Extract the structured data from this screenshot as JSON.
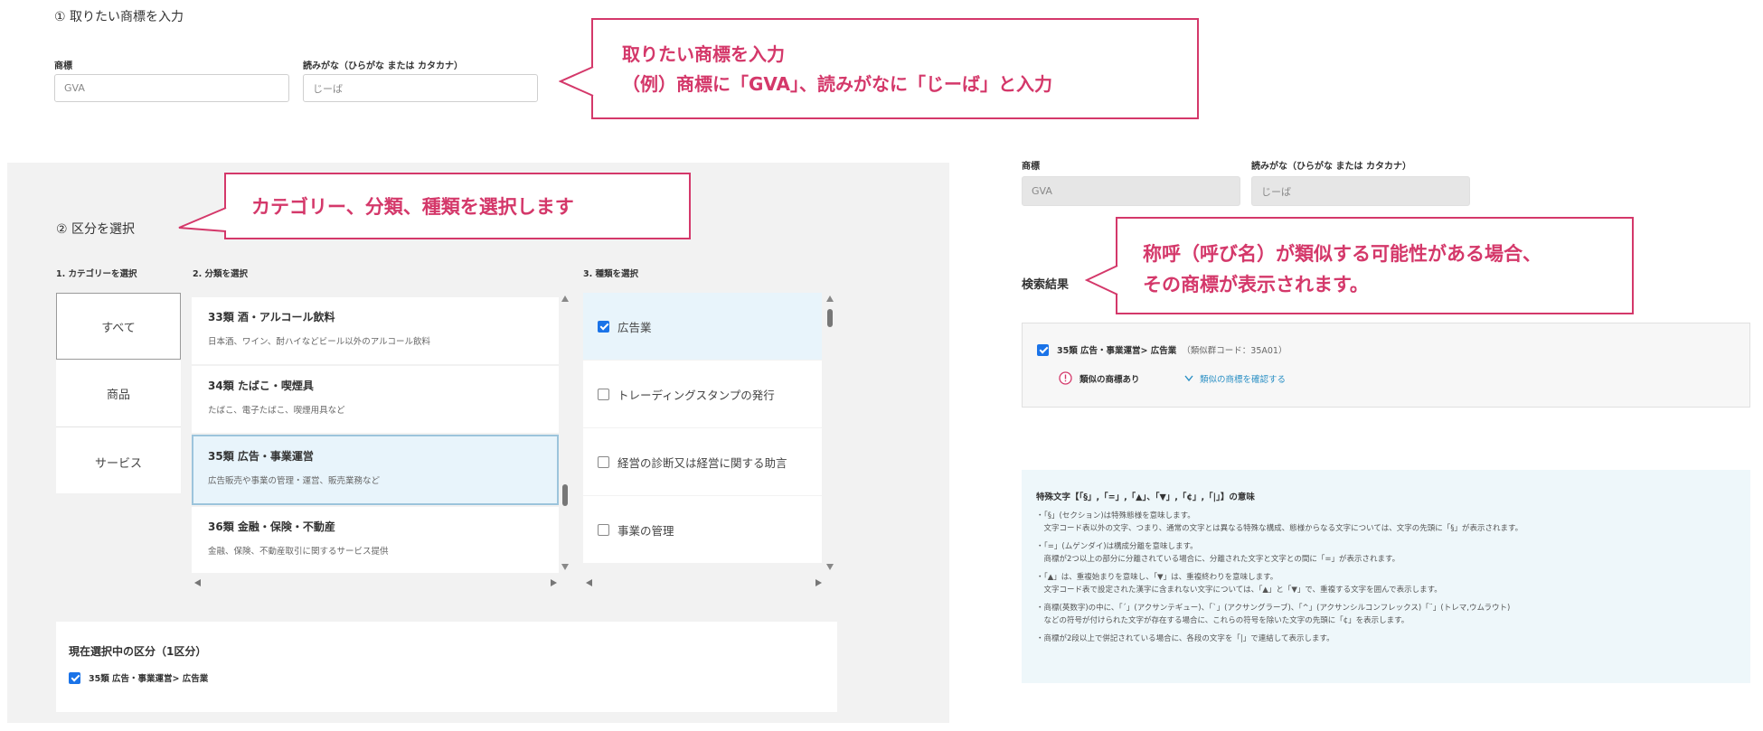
{
  "section1": {
    "title": "① 取りたい商標を入力",
    "trademark_label": "商標",
    "trademark_value": "GVA",
    "reading_label": "読みがな（ひらがな または カタカナ）",
    "reading_value": "じーば"
  },
  "callout1": {
    "line1": "取りたい商標を入力",
    "line2": "（例）商標に「GVA」、読みがなに「じーば」と入力"
  },
  "section2": {
    "title": "② 区分を選択",
    "col1_header": "1. カテゴリーを選択",
    "col2_header": "2. 分類を選択",
    "col3_header": "3. 種類を選択",
    "categories": [
      "すべて",
      "商品",
      "サービス"
    ],
    "classes": [
      {
        "title": "33類 酒・アルコール飲料",
        "desc": "日本酒、ワイン、酎ハイなどビール以外のアルコール飲料"
      },
      {
        "title": "34類 たばこ・喫煙具",
        "desc": "たばこ、電子たばこ、喫煙用具など"
      },
      {
        "title": "35類 広告・事業運営",
        "desc": "広告販売や事業の管理・運営、販売業務など"
      },
      {
        "title": "36類 金融・保険・不動産",
        "desc": "金融、保険、不動産取引に関するサービス提供"
      }
    ],
    "kinds": [
      {
        "label": "広告業",
        "checked": true
      },
      {
        "label": "トレーディングスタンプの発行",
        "checked": false
      },
      {
        "label": "経営の診断又は経営に関する助言",
        "checked": false
      },
      {
        "label": "事業の管理",
        "checked": false
      }
    ]
  },
  "callout2": {
    "text": "カテゴリー、分類、種類を選択します"
  },
  "current_selection": {
    "title": "現在選択中の区分（1区分）",
    "item": "35類 広告・事業運営> 広告業"
  },
  "right": {
    "trademark_label": "商標",
    "trademark_value": "GVA",
    "reading_label": "読みがな（ひらがな または カタカナ）",
    "reading_value": "じーば",
    "results_title": "検索結果",
    "result_item": "35類 広告・事業運営> 広告業",
    "result_code": "（類似群コード：35A01）",
    "similar_label": "類似の商標あり",
    "check_similar": "類似の商標を確認する"
  },
  "callout3": {
    "line1": "称呼（呼び名）が類似する可能性がある場合、",
    "line2": "その商標が表示されます。"
  },
  "info": {
    "title": "特殊文字【「§」,「=」,「▲」、「▼」,「¢」,「|」】の意味",
    "lines": [
      "・「§」(セクション)は特殊態様を意味します。",
      "　文字コード表以外の文字、つまり、通常の文字とは異なる特殊な構成、態様からなる文字については、文字の先頭に「§」が表示されます。",
      "・「=」(ムゲンダイ)は構成分離を意味します。",
      "　商標が2つ以上の部分に分離されている場合に、分離された文字と文字との間に「=」が表示されます。",
      "・「▲」は、重複始まりを意味し、「▼」は、重複終わりを意味します。",
      "　文字コード表で設定された漢字に含まれない文字については、「▲」と「▼」で、重複する文字を囲んで表示します。",
      "・商標(英数字)の中に、「´」(アクサンテギュー)、「`」(アクサングラーブ)、「^」(アクサンシルコンフレックス)「¨」(トレマ,ウムラウト)",
      "　などの符号が付けられた文字が存在する場合に、これらの符号を除いた文字の先頭に「¢」を表示します。",
      "・商標が2段以上で併記されている場合に、各段の文字を「|」で連結して表示します。"
    ]
  },
  "colors": {
    "accent": "#d4386a",
    "check": "#1a73e8",
    "selected_bg": "#e8f4fb"
  }
}
